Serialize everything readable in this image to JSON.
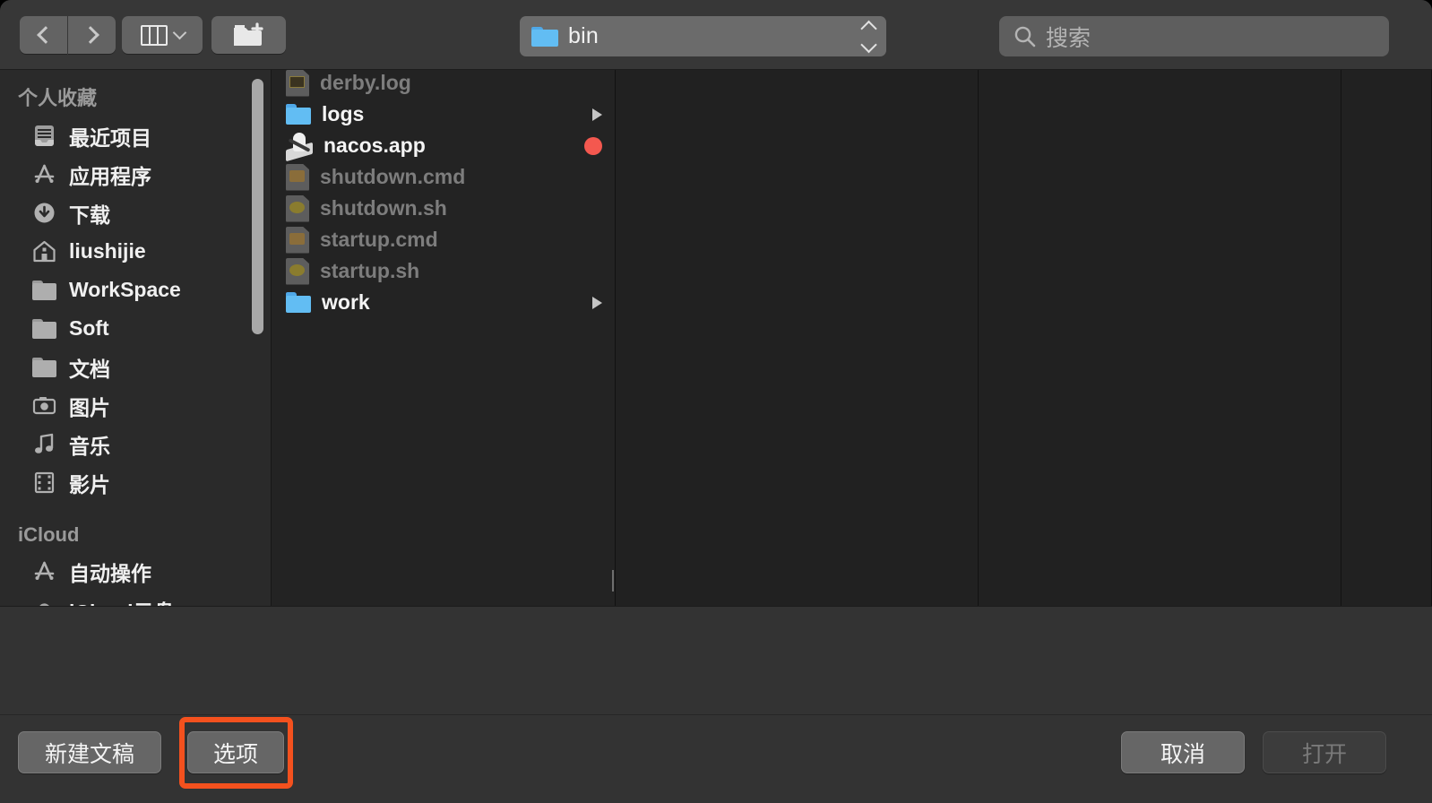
{
  "window": {
    "title": "bin"
  },
  "toolbar": {
    "back_label": "Back",
    "forward_label": "Forward",
    "view_mode_label": "Column view",
    "new_folder_label": "New Folder",
    "path": {
      "name": "bin",
      "icon": "folder-icon"
    },
    "search": {
      "placeholder": "搜索",
      "value": "",
      "icon": "search-icon"
    }
  },
  "sidebar": {
    "sections": [
      {
        "header": "个人收藏",
        "items": [
          {
            "label": "最近项目",
            "icon": "recents-icon"
          },
          {
            "label": "应用程序",
            "icon": "applications-icon"
          },
          {
            "label": "下载",
            "icon": "downloads-icon"
          },
          {
            "label": "liushijie",
            "icon": "home-icon"
          },
          {
            "label": "WorkSpace",
            "icon": "folder-icon"
          },
          {
            "label": "Soft",
            "icon": "folder-icon"
          },
          {
            "label": "文档",
            "icon": "folder-icon"
          },
          {
            "label": "图片",
            "icon": "camera-icon"
          },
          {
            "label": "音乐",
            "icon": "music-note-icon"
          },
          {
            "label": "影片",
            "icon": "film-strip-icon"
          }
        ]
      },
      {
        "header": "iCloud",
        "items": [
          {
            "label": "自动操作",
            "icon": "automator-icon"
          },
          {
            "label": "iCloud云盘",
            "icon": "cloud-icon"
          }
        ]
      }
    ]
  },
  "file_list": {
    "items": [
      {
        "name": "derby.log",
        "icon": "log-file-icon",
        "enabled": false,
        "disclosure": false,
        "badge": null
      },
      {
        "name": "logs",
        "icon": "folder-icon",
        "enabled": true,
        "disclosure": true,
        "badge": null
      },
      {
        "name": "nacos.app",
        "icon": "nacos-app-icon",
        "enabled": true,
        "disclosure": false,
        "badge": "red-dot"
      },
      {
        "name": "shutdown.cmd",
        "icon": "cmd-file-icon",
        "enabled": false,
        "disclosure": false,
        "badge": null
      },
      {
        "name": "shutdown.sh",
        "icon": "shell-file-icon",
        "enabled": false,
        "disclosure": false,
        "badge": null
      },
      {
        "name": "startup.cmd",
        "icon": "cmd-file-icon",
        "enabled": false,
        "disclosure": false,
        "badge": null
      },
      {
        "name": "startup.sh",
        "icon": "shell-file-icon",
        "enabled": false,
        "disclosure": false,
        "badge": null
      },
      {
        "name": "work",
        "icon": "folder-icon",
        "enabled": true,
        "disclosure": true,
        "badge": null
      }
    ]
  },
  "footer": {
    "new_document_label": "新建文稿",
    "options_label": "选项",
    "cancel_label": "取消",
    "open_label": "打开",
    "open_disabled": true,
    "highlight_target": "选项"
  },
  "colors": {
    "window_bg": "#2e2e2e",
    "toolbar_bg": "#373737",
    "sidebar_bg": "#2a2a2a",
    "column_bg": "#212121",
    "accent_folder": "#4fa8e8",
    "badge_red": "#f4584f",
    "highlight_orange": "#f4511e",
    "text_primary": "#f2f2f2",
    "text_dim": "#7d7d7d"
  }
}
